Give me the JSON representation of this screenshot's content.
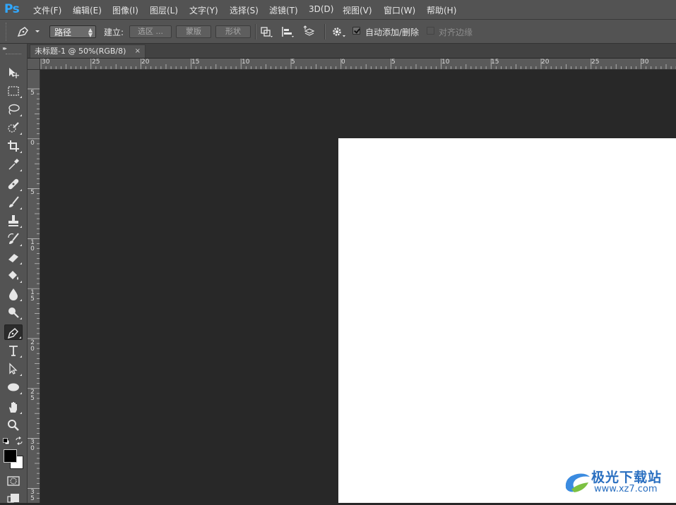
{
  "app": {
    "logo": "Ps"
  },
  "menu": [
    "文件(F)",
    "编辑(E)",
    "图像(I)",
    "图层(L)",
    "文字(Y)",
    "选择(S)",
    "滤镜(T)",
    "3D(D)",
    "视图(V)",
    "窗口(W)",
    "帮助(H)"
  ],
  "options": {
    "mode_select": "路径",
    "make_label": "建立:",
    "selection_btn": "选区 ...",
    "mask_btn": "蒙版",
    "shape_btn": "形状",
    "auto_add_delete": {
      "label": "自动添加/删除",
      "checked": true
    },
    "align_edges": {
      "label": "对齐边缘",
      "checked": false
    }
  },
  "tools": [
    {
      "name": "move-tool",
      "icon": "move-icon"
    },
    {
      "name": "marquee-tool",
      "icon": "rect-marquee-icon"
    },
    {
      "name": "lasso-tool",
      "icon": "lasso-icon"
    },
    {
      "name": "quick-select-tool",
      "icon": "quick-select-icon"
    },
    {
      "name": "crop-tool",
      "icon": "crop-icon"
    },
    {
      "name": "eyedropper-tool",
      "icon": "eyedropper-icon"
    },
    {
      "name": "healing-tool",
      "icon": "bandage-icon"
    },
    {
      "name": "brush-tool",
      "icon": "brush-icon"
    },
    {
      "name": "stamp-tool",
      "icon": "stamp-icon"
    },
    {
      "name": "history-brush-tool",
      "icon": "history-brush-icon"
    },
    {
      "name": "eraser-tool",
      "icon": "eraser-icon"
    },
    {
      "name": "paint-bucket-tool",
      "icon": "bucket-icon"
    },
    {
      "name": "blur-tool",
      "icon": "drop-icon"
    },
    {
      "name": "dodge-tool",
      "icon": "dodge-icon"
    },
    {
      "name": "pen-tool",
      "icon": "pen-icon",
      "active": true
    },
    {
      "name": "type-tool",
      "icon": "type-icon"
    },
    {
      "name": "path-select-tool",
      "icon": "path-select-icon"
    },
    {
      "name": "ellipse-tool",
      "icon": "ellipse-icon"
    },
    {
      "name": "hand-tool",
      "icon": "hand-icon"
    },
    {
      "name": "zoom-tool",
      "icon": "zoom-icon"
    }
  ],
  "colors": {
    "foreground": "#000000",
    "background": "#ffffff",
    "accent": "#31a8ff"
  },
  "document": {
    "tab_title": "未标题-1 @ 50%(RGB/8)",
    "close_glyph": "×"
  },
  "ruler": {
    "top_labels": [
      "30",
      "25",
      "20",
      "15",
      "10",
      "5",
      "0",
      "5",
      "10",
      "15",
      "20",
      "25",
      "30"
    ],
    "left_labels": [
      "5",
      "0",
      "5",
      "10",
      "15",
      "20",
      "25",
      "30",
      "35"
    ]
  },
  "watermark": {
    "title": "极光下载站",
    "url": "www.xz7.com"
  }
}
